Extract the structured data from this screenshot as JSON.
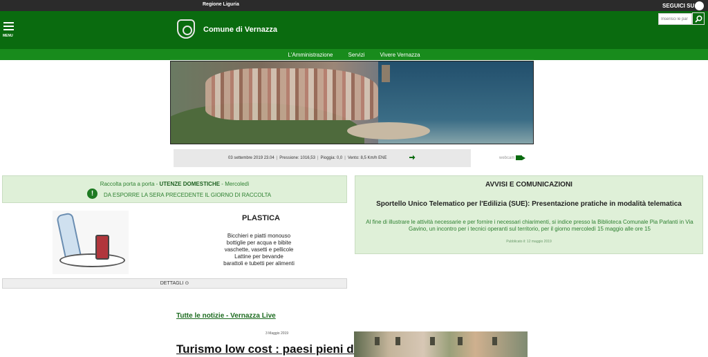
{
  "topbar": {
    "region": "Regione Liguria",
    "follow": "SEGUICI SU:"
  },
  "header": {
    "menu_label": "MENU",
    "title": "Comune di Vernazza",
    "search_placeholder": "Inserisci le par",
    "brand_color": "#0a6b0f"
  },
  "nav": {
    "items": [
      "L'Amministrazione",
      "Servizi",
      "Vivere Vernazza"
    ]
  },
  "weather": {
    "date": "03 settembre 2019 23.04",
    "pressure": "Pressione: 1016,53",
    "rain": "Pioggia: 0,0",
    "wind": "Vento: 8,5 Km/h ENE"
  },
  "webcam": {
    "label": "webcam"
  },
  "raccolta": {
    "prefix": "Raccolta porta a porta - ",
    "type": "UTENZE DOMESTICHE",
    "suffix": " - Mercoledì",
    "note": "DA ESPORRE LA SERA PRECEDENTE IL GIORNO DI RACCOLTA"
  },
  "plastica": {
    "title": "PLASTICA",
    "items": [
      "Bicchieri e piatti monouso",
      "bottiglie per acqua e bibite",
      "vaschette, vasetti e pellicole",
      "Lattine per bevande",
      "barattoli e tubetti per alimenti"
    ],
    "details": "DETTAGLI ⊙"
  },
  "avvisi": {
    "heading": "AVVISI E COMUNICAZIONI",
    "title": "Sportello Unico Telematico per l'Edilizia (SUE): Presentazione pratiche in modalità telematica",
    "desc": "Al fine di illustrare le attività necessarie e per fornire i necessari chiarimenti, si indice presso la Biblioteca Comunale     Pia Parlanti in Via Gavino, un incontro per i tecnici operanti sul territorio, per il giorno mercoledì 15 maggio alle ore 15",
    "published": "Pubblicato il: 12 maggio 2019"
  },
  "news": {
    "link": "Tutte le notizie - Vernazza Live",
    "date": "3 Maggio 2019",
    "title": "Turismo low cost : paesi pieni di"
  }
}
